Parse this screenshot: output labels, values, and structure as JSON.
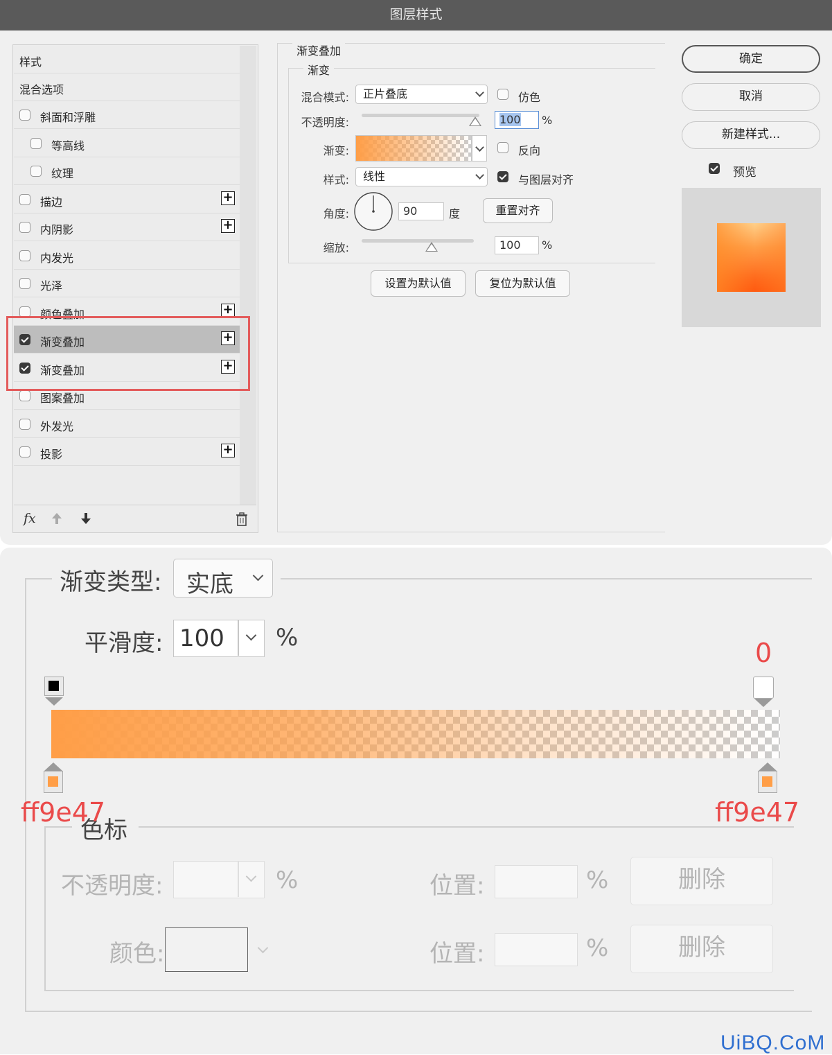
{
  "dialog": {
    "title": "图层样式",
    "styles_header": "样式",
    "blend_options": "混合选项",
    "items": [
      {
        "label": "斜面和浮雕",
        "checked": false,
        "plus": false,
        "indent": 0
      },
      {
        "label": "等高线",
        "checked": false,
        "plus": false,
        "indent": 1
      },
      {
        "label": "纹理",
        "checked": false,
        "plus": false,
        "indent": 1
      },
      {
        "label": "描边",
        "checked": false,
        "plus": true,
        "indent": 0
      },
      {
        "label": "内阴影",
        "checked": false,
        "plus": true,
        "indent": 0
      },
      {
        "label": "内发光",
        "checked": false,
        "plus": false,
        "indent": 0
      },
      {
        "label": "光泽",
        "checked": false,
        "plus": false,
        "indent": 0
      },
      {
        "label": "颜色叠加",
        "checked": false,
        "plus": true,
        "indent": 0
      },
      {
        "label": "渐变叠加",
        "checked": true,
        "plus": true,
        "indent": 0,
        "selected": true
      },
      {
        "label": "渐变叠加",
        "checked": true,
        "plus": true,
        "indent": 0
      },
      {
        "label": "图案叠加",
        "checked": false,
        "plus": false,
        "indent": 0
      },
      {
        "label": "外发光",
        "checked": false,
        "plus": false,
        "indent": 0
      },
      {
        "label": "投影",
        "checked": false,
        "plus": true,
        "indent": 0
      }
    ],
    "footer": {
      "fx": "fx",
      "up_icon": "arrow-up-icon",
      "down_icon": "arrow-down-icon",
      "trash_icon": "trash-icon"
    },
    "gradient_overlay": {
      "section_title": "渐变叠加",
      "sub_title": "渐变",
      "blend_mode_label": "混合模式:",
      "blend_mode_value": "正片叠底",
      "dither_label": "仿色",
      "opacity_label": "不透明度:",
      "opacity_value": "100",
      "percent": "%",
      "gradient_label": "渐变:",
      "reverse_label": "反向",
      "style_label": "样式:",
      "style_value": "线性",
      "align_label": "与图层对齐",
      "angle_label": "角度:",
      "angle_value": "90",
      "degree": "度",
      "reset_align": "重置对齐",
      "scale_label": "缩放:",
      "scale_value": "100",
      "set_default": "设置为默认值",
      "reset_default": "复位为默认值"
    },
    "buttons": {
      "ok": "确定",
      "cancel": "取消",
      "new_style": "新建样式...",
      "preview": "预览"
    },
    "colors": {
      "accent_orange": "#ff9e47",
      "highlight_red": "#e35b5b"
    }
  },
  "editor": {
    "gradient_type_label": "渐变类型:",
    "gradient_type_value": "实底",
    "smoothness_label": "平滑度:",
    "smoothness_value": "100",
    "percent": "%",
    "annotation_zero": "0",
    "annotation_left_color": "ff9e47",
    "annotation_right_color": "ff9e47",
    "color_stops_title": "色标",
    "stop_opacity_label": "不透明度:",
    "position_label": "位置:",
    "delete_label": "删除",
    "color_label": "颜色:",
    "watermark": "UiBQ.CoM"
  }
}
